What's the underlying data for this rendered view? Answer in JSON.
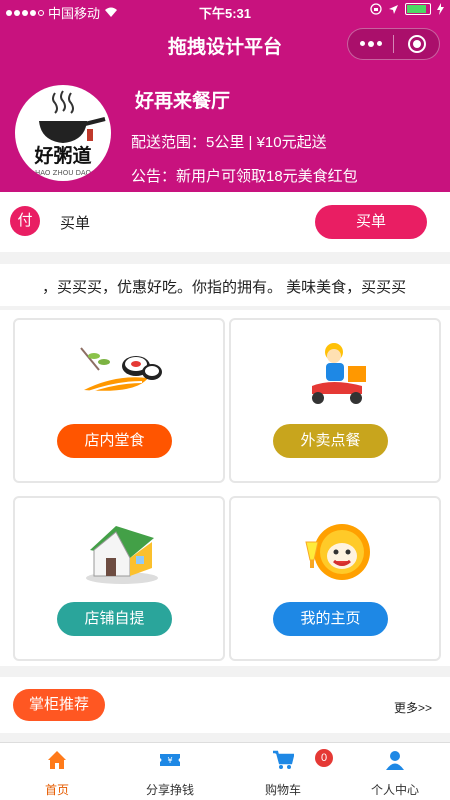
{
  "status_bar": {
    "carrier": "中国移动",
    "time": "下午5:31"
  },
  "nav": {
    "title": "拖拽设计平台",
    "more_icon": "more-dots-icon",
    "close_icon": "target-circle-icon"
  },
  "shop": {
    "logo_text": "好粥道",
    "logo_subtext": "HAO ZHOU DAO",
    "name": "好再来餐厅",
    "range": "配送范围：5公里 | ¥10元起送",
    "notice": "公告：新用户可领取18元美食红包"
  },
  "pay": {
    "icon_text": "付",
    "label": "买单",
    "button": "买单"
  },
  "marquee": {
    "text": "，买买买，优惠好吃。你指的拥有。 美味美食，买买买"
  },
  "grid": [
    {
      "label": "店内堂食",
      "icon": "sushi-icon",
      "color": "#ff5500"
    },
    {
      "label": "外卖点餐",
      "icon": "delivery-scooter-icon",
      "color": "#c8a51d"
    },
    {
      "label": "店铺自提",
      "icon": "house-icon",
      "color": "#2aa59b"
    },
    {
      "label": "我的主页",
      "icon": "mascot-icon",
      "color": "#1e88e5"
    }
  ],
  "recommend": {
    "badge": "掌柜推荐",
    "more": "更多>>"
  },
  "tabbar": [
    {
      "label": "首页",
      "icon": "home-icon",
      "active": true
    },
    {
      "label": "分享挣钱",
      "icon": "ticket-icon",
      "active": false
    },
    {
      "label": "购物车",
      "icon": "cart-icon",
      "active": false,
      "badge": "0"
    },
    {
      "label": "个人中心",
      "icon": "user-icon",
      "active": false
    }
  ],
  "colors": {
    "brand": "#c8127e",
    "pay": "#e91e63",
    "active_tab": "#e65c00"
  }
}
